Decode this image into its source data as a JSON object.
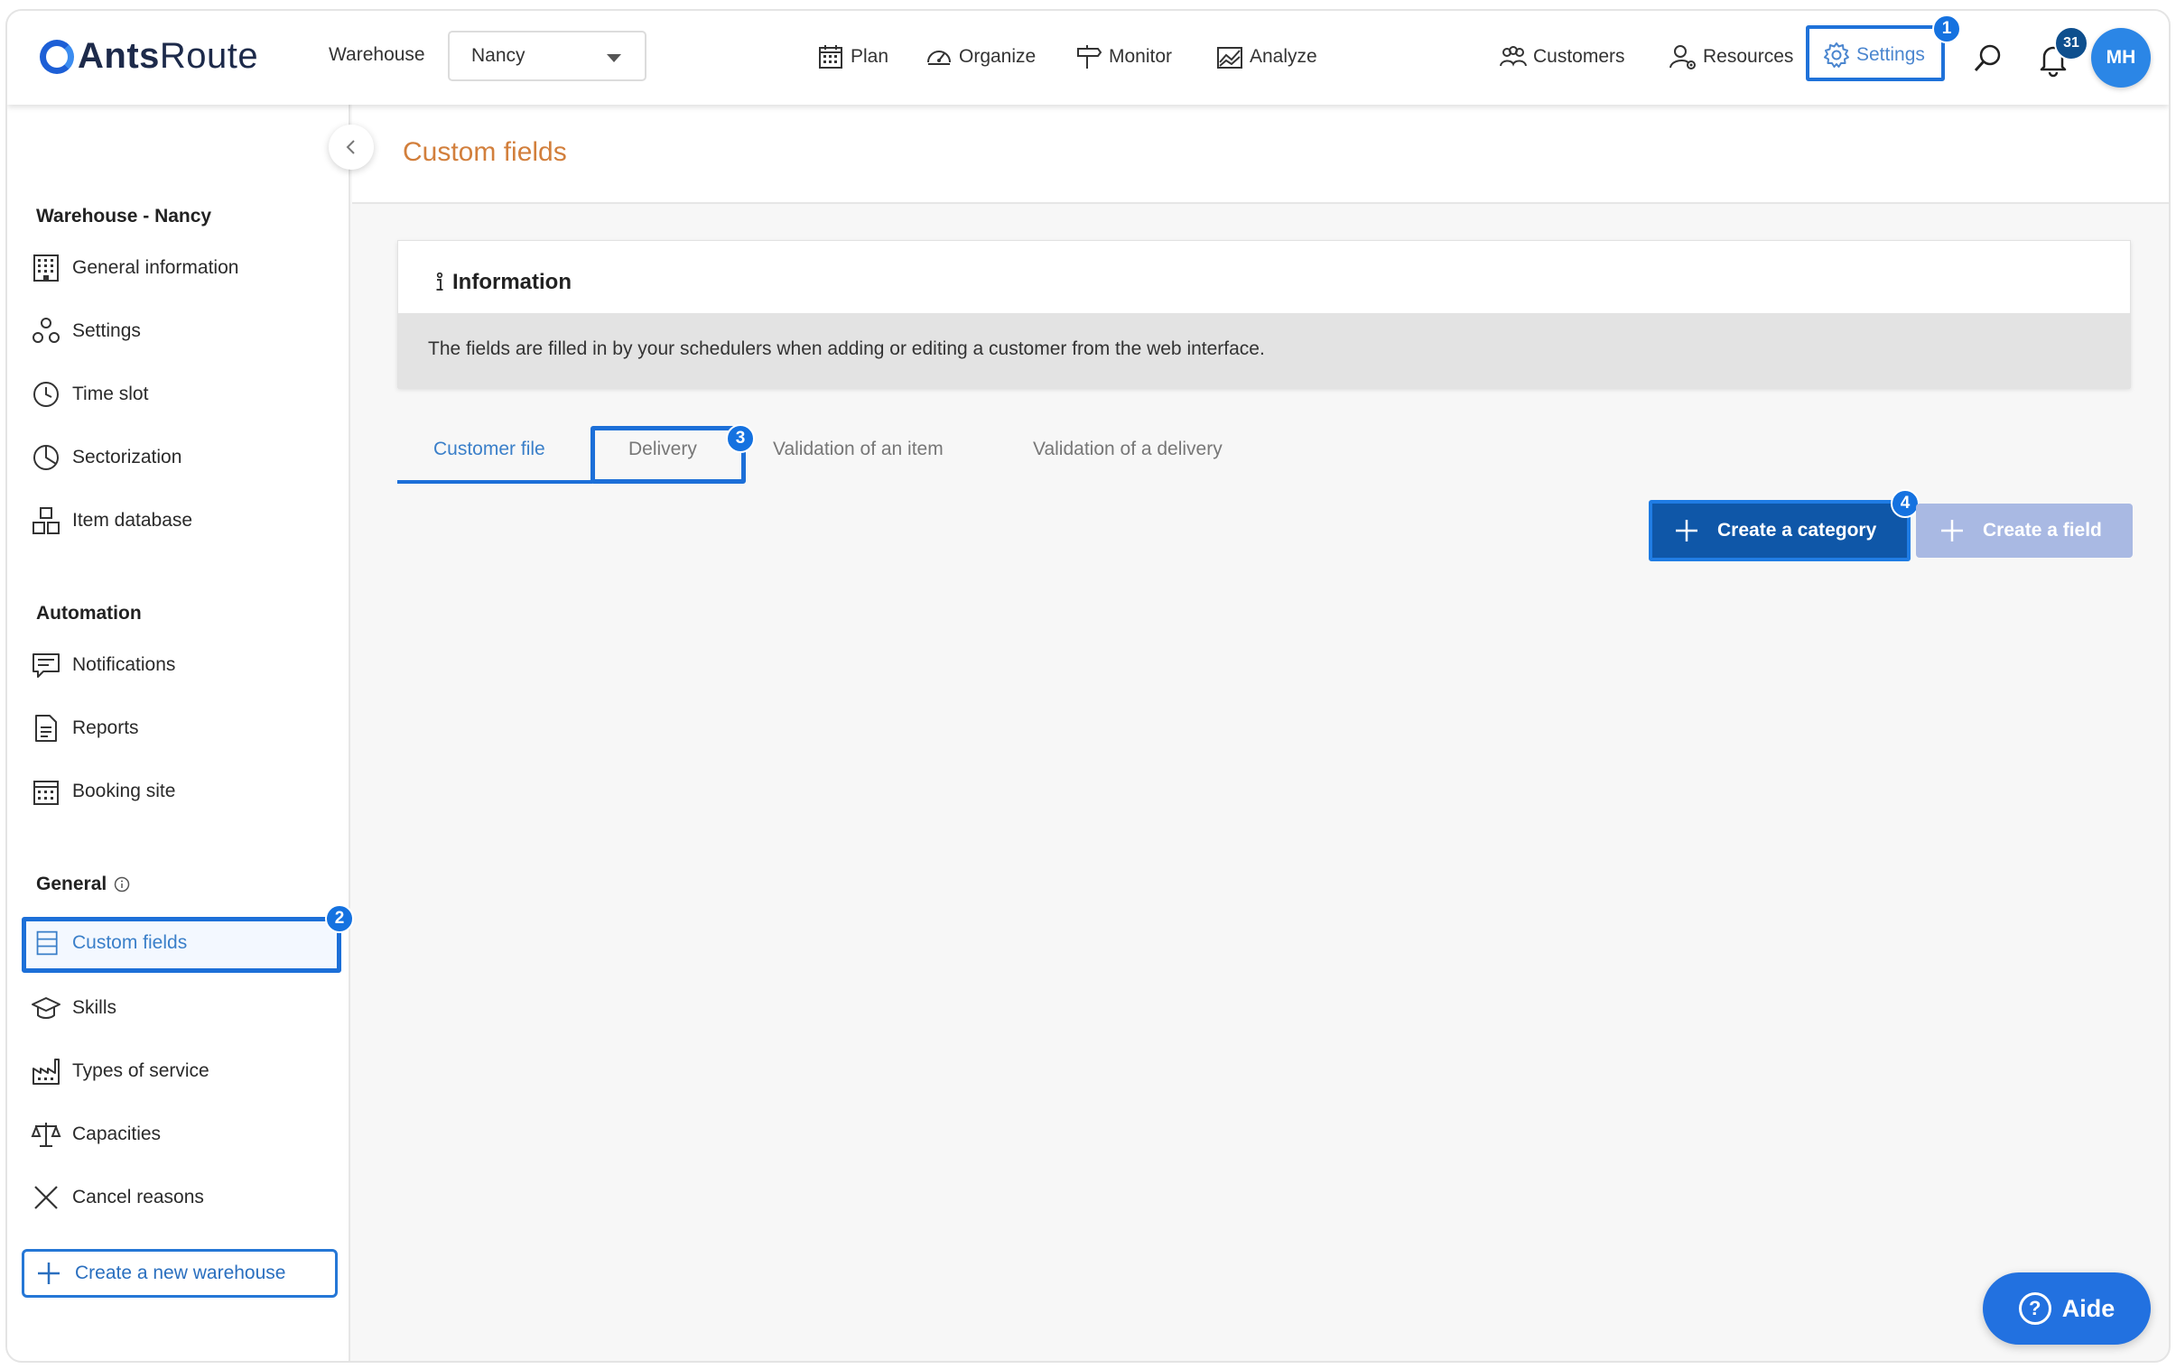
{
  "brand": {
    "name_bold": "Ants",
    "name_rest": "Route"
  },
  "topbar": {
    "warehouse_label": "Warehouse",
    "warehouse_value": "Nancy",
    "nav": {
      "plan": "Plan",
      "organize": "Organize",
      "monitor": "Monitor",
      "analyze": "Analyze"
    },
    "right_nav": {
      "customers": "Customers",
      "resources": "Resources",
      "settings": "Settings"
    },
    "notifications_count": "31",
    "avatar_initials": "MH",
    "settings_step": "1"
  },
  "sidebar": {
    "section_warehouse": "Warehouse - Nancy",
    "warehouse_items": [
      "General information",
      "Settings",
      "Time slot",
      "Sectorization",
      "Item database"
    ],
    "section_automation": "Automation",
    "automation_items": [
      "Notifications",
      "Reports",
      "Booking site"
    ],
    "section_general": "General",
    "general_items": [
      "Custom fields",
      "Skills",
      "Types of service",
      "Capacities",
      "Cancel reasons"
    ],
    "custom_fields_step": "2",
    "create_warehouse": "Create a new warehouse"
  },
  "main": {
    "page_title": "Custom fields",
    "info_title": "Information",
    "info_text": "The fields are filled in by your schedulers when adding or editing a customer from the web interface.",
    "tabs": [
      "Customer file",
      "Delivery",
      "Validation of an item",
      "Validation of a delivery"
    ],
    "delivery_step": "3",
    "create_category": "Create a category",
    "create_category_step": "4",
    "create_field": "Create a field"
  },
  "help": {
    "label": "Aide"
  },
  "colors": {
    "accent": "#1c6fd8",
    "title_orange": "#d27f3c",
    "primary_button": "#0f57a8",
    "disabled_button": "#a9b9e3"
  }
}
